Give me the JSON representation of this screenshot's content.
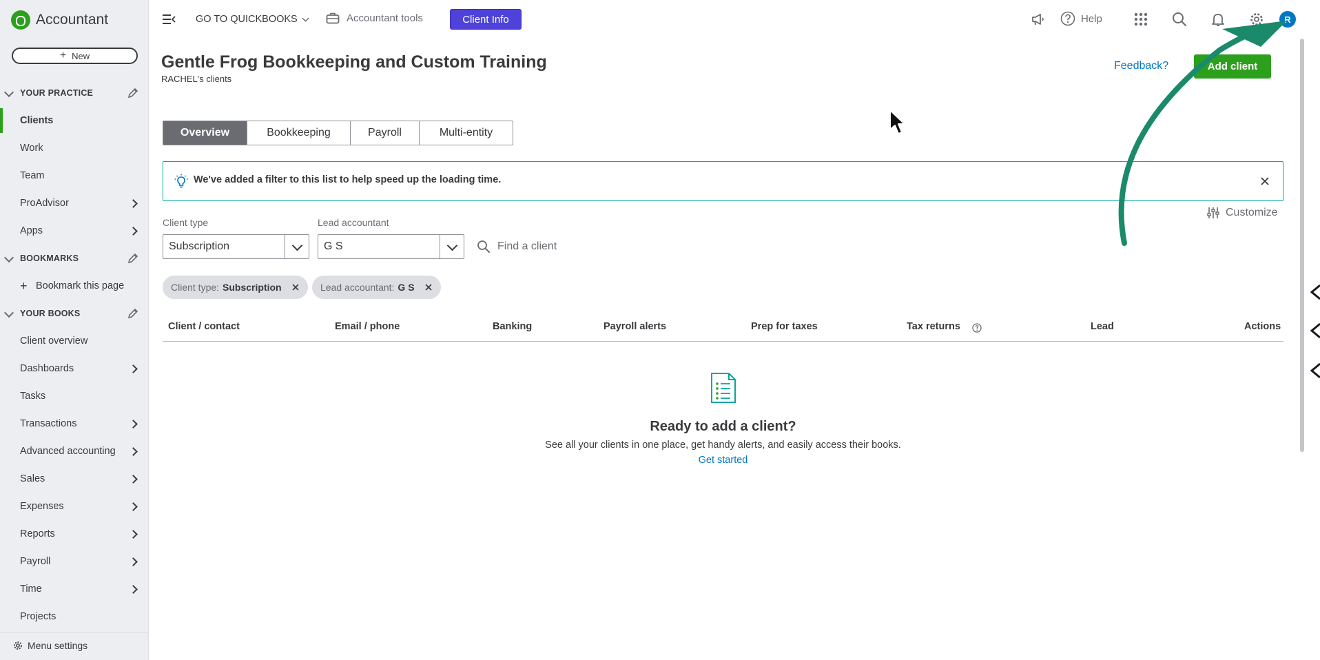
{
  "brand": {
    "name": "Accountant"
  },
  "sidebar": {
    "new_label": "New",
    "sections": {
      "your_practice": "YOUR PRACTICE",
      "bookmarks": "BOOKMARKS",
      "your_books": "YOUR BOOKS"
    },
    "practice_items": [
      {
        "label": "Clients"
      },
      {
        "label": "Work"
      },
      {
        "label": "Team"
      },
      {
        "label": "ProAdvisor"
      },
      {
        "label": "Apps"
      }
    ],
    "bookmark_item": "Bookmark this page",
    "books_items": [
      {
        "label": "Client overview"
      },
      {
        "label": "Dashboards"
      },
      {
        "label": "Tasks"
      },
      {
        "label": "Transactions"
      },
      {
        "label": "Advanced accounting"
      },
      {
        "label": "Sales"
      },
      {
        "label": "Expenses"
      },
      {
        "label": "Reports"
      },
      {
        "label": "Payroll"
      },
      {
        "label": "Time"
      },
      {
        "label": "Projects"
      }
    ],
    "menu_settings": "Menu settings"
  },
  "topbar": {
    "goto": "GO TO QUICKBOOKS",
    "accountant_tools": "Accountant tools",
    "client_info": "Client Info",
    "help": "Help",
    "avatar_initial": "R"
  },
  "header": {
    "title": "Gentle Frog Bookkeeping and Custom Training",
    "subtitle": "RACHEL's clients",
    "feedback": "Feedback?",
    "add_client": "Add client"
  },
  "tabs": [
    {
      "label": "Overview"
    },
    {
      "label": "Bookkeeping"
    },
    {
      "label": "Payroll"
    },
    {
      "label": "Multi-entity"
    }
  ],
  "banner": {
    "message": "We've added a filter to this list to help speed up the loading time."
  },
  "customize": "Customize",
  "filters": {
    "client_type_label": "Client type",
    "client_type_value": "Subscription",
    "lead_label": "Lead accountant",
    "lead_value": "G S",
    "search_placeholder": "Find a client"
  },
  "chips": [
    {
      "key": "Client type:",
      "value": "Subscription"
    },
    {
      "key": "Lead accountant:",
      "value": "G S"
    }
  ],
  "table": {
    "columns": [
      "Client / contact",
      "Email / phone",
      "Banking",
      "Payroll alerts",
      "Prep for taxes",
      "Tax returns",
      "Lead",
      "Actions"
    ]
  },
  "empty_state": {
    "title": "Ready to add a client?",
    "description": "See all your clients in one place, get handy alerts, and easily access their books.",
    "link": "Get started"
  },
  "colors": {
    "brand_green": "#2ca01c",
    "client_info_purple": "#4e42d9",
    "link_blue": "#0077c5",
    "banner_teal": "#00a6a4",
    "annotation_arrow": "#1b8a6b"
  }
}
